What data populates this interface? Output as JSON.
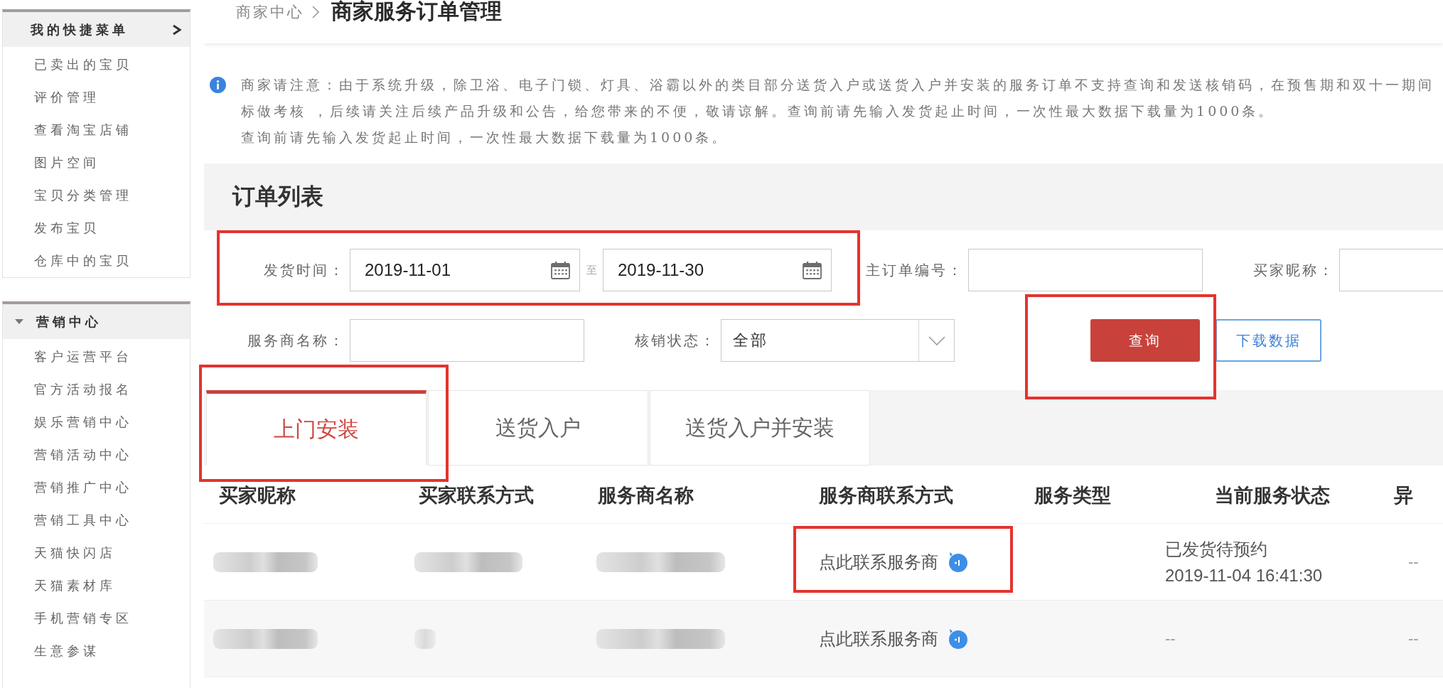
{
  "sidebar": {
    "sections": [
      {
        "kind": "shortcut",
        "title": "我的快捷菜单",
        "expanded": true,
        "items": [
          "已卖出的宝贝",
          "评价管理",
          "查看淘宝店铺",
          "图片空间",
          "宝贝分类管理",
          "发布宝贝",
          "仓库中的宝贝"
        ]
      },
      {
        "kind": "group",
        "title": "营销中心",
        "expanded": true,
        "items": [
          "客户运营平台",
          "官方活动报名",
          "娱乐营销中心",
          "营销活动中心",
          "营销推广中心",
          "营销工具中心",
          "天猫快闪店",
          "天猫素材库",
          "手机营销专区",
          "生意参谋"
        ]
      }
    ]
  },
  "breadcrumb": {
    "parent": "商家中心",
    "current": "商家服务订单管理"
  },
  "notice": {
    "lines": [
      "商家请注意：由于系统升级，除卫浴、电子门锁、灯具、浴霸以外的类目部分送货入户或送货入户并安装的服务订单不支持查询和发送核销码，在预售期和双十一期间",
      "标做考核 ，后续请关注后续产品升级和公告，给您带来的不便，敬请谅解。查询前请先输入发货起止时间，一次性最大数据下载量为1000条。",
      "查询前请先输入发货起止时间，一次性最大数据下载量为1000条。"
    ]
  },
  "order_list": {
    "title": "订单列表",
    "filter_rows": [
      [
        {
          "kind": "daterange",
          "label": "发货时间：",
          "from": "2019-11-01",
          "separator": "至",
          "to": "2019-11-30"
        },
        {
          "kind": "text",
          "label": "主订单编号："
        },
        {
          "kind": "text",
          "label": "买家昵称："
        }
      ],
      [
        {
          "kind": "text",
          "label": "服务商名称："
        },
        {
          "kind": "select",
          "label": "核销状态：",
          "value": "全部"
        }
      ]
    ],
    "buttons": [
      {
        "kind": "primary",
        "label": "查询"
      },
      {
        "kind": "outline",
        "label": "下载数据"
      }
    ],
    "tabs": [
      {
        "label": "上门安装",
        "selected": true
      },
      {
        "label": "送货入户",
        "selected": false
      },
      {
        "label": "送货入户并安装",
        "selected": false
      }
    ],
    "table": {
      "columns": [
        "买家昵称",
        "买家联系方式",
        "服务商名称",
        "服务商联系方式",
        "服务类型",
        "当前服务状态",
        "异"
      ],
      "rows": [
        [
          {
            "kind": "blurred"
          },
          {
            "kind": "blurred"
          },
          {
            "kind": "blurred"
          },
          {
            "kind": "contact",
            "text": "点此联系服务商"
          },
          {
            "kind": "empty"
          },
          {
            "kind": "status",
            "status": "已发货待预约",
            "time": "2019-11-04 16:41:30"
          },
          {
            "kind": "text",
            "text": "--"
          }
        ],
        [
          {
            "kind": "blurred"
          },
          {
            "kind": "smudge"
          },
          {
            "kind": "blurred"
          },
          {
            "kind": "contact",
            "text": "点此联系服务商"
          },
          {
            "kind": "empty"
          },
          {
            "kind": "text",
            "text": "--"
          },
          {
            "kind": "text",
            "text": "--"
          }
        ]
      ]
    }
  }
}
